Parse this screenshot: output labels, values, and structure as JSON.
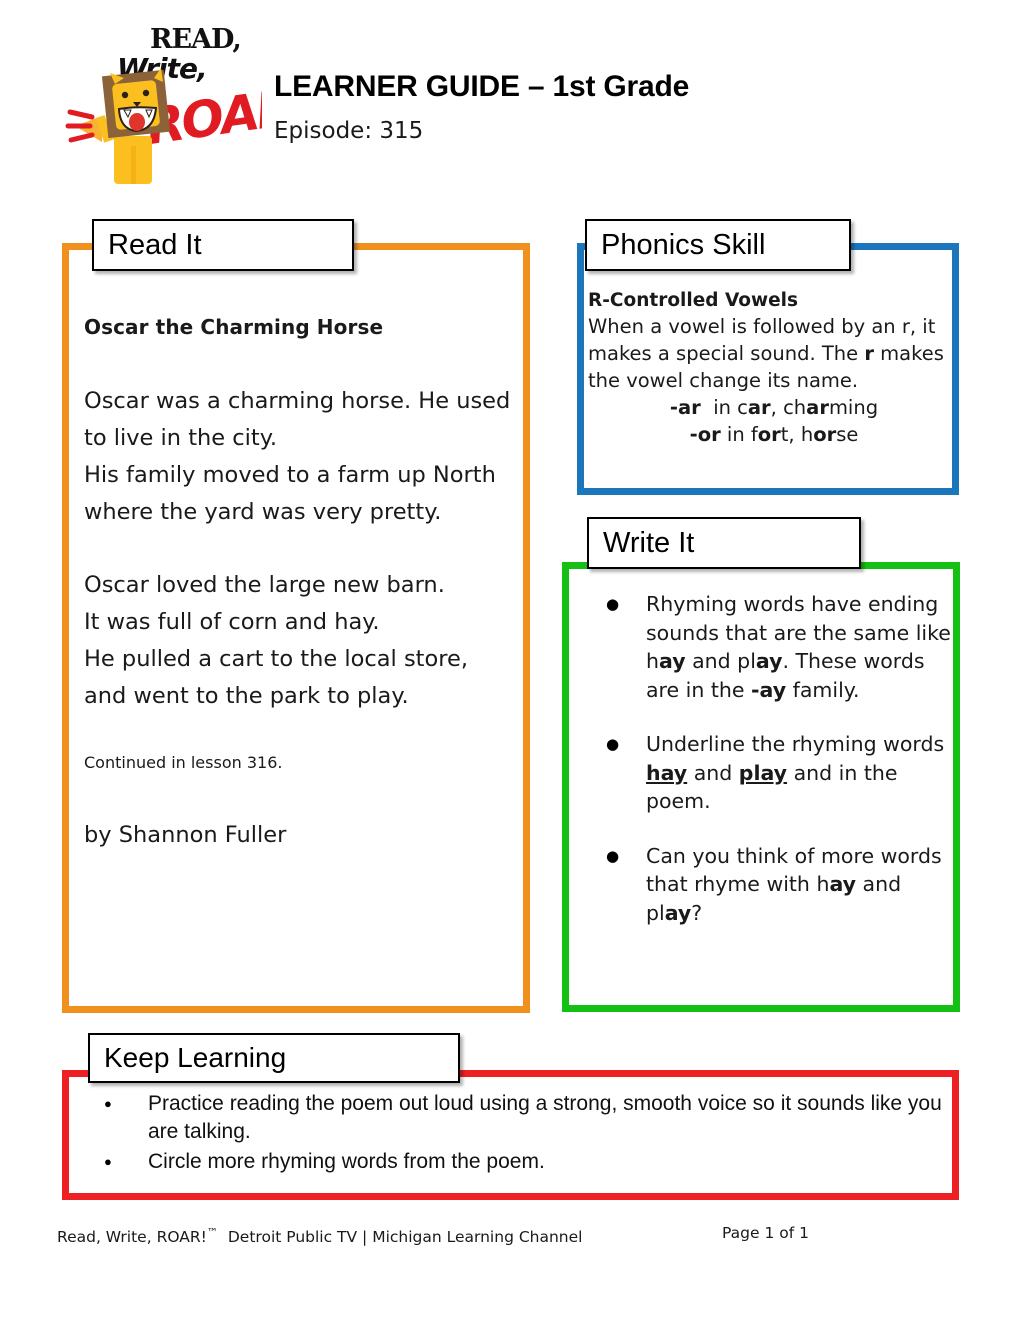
{
  "header": {
    "logo_alt": "Read, Write, ROAR! lion mascot logo",
    "logo_word1": "READ,",
    "logo_word2": "Write,",
    "logo_word3": "ROAR!",
    "title": "LEARNER GUIDE – 1st Grade",
    "episode": "Episode: 315"
  },
  "panels": {
    "read_it": {
      "tab_label": "Read It",
      "border_color": "#F0911E",
      "poem_title": "Oscar the Charming Horse",
      "stanza_1": "Oscar was a charming horse. He used to live in the city.\nHis family moved to a farm up North\nwhere the yard was very pretty.",
      "stanza_1_lines": [
        "Oscar was a charming horse. He used to live in the city.",
        "His family moved to a farm up North",
        "where the yard was very pretty."
      ],
      "stanza_2_lines": [
        "Oscar loved the large new barn.",
        "It was full of corn and hay.",
        "He pulled a cart to the local store,",
        "and went to the park to play."
      ],
      "continued_note": "Continued in lesson 316.",
      "author": "by Shannon Fuller"
    },
    "phonics_skill": {
      "tab_label": "Phonics Skill",
      "border_color": "#1B76BC",
      "heading": "R-Controlled Vowels",
      "body_part_1": "When a vowel is followed by an r, it makes a special sound. The ",
      "body_bold_r": "r",
      "body_part_2": " makes the vowel change its name.",
      "example_ar_prefix": "-ar",
      "example_ar_text": "in c",
      "example_ar_bold1": "ar",
      "example_ar_mid": ", ch",
      "example_ar_bold2": "ar",
      "example_ar_end": "ming",
      "example_or_prefix": "-or",
      "example_or_text": "in f",
      "example_or_bold1": "or",
      "example_or_mid": "t, h",
      "example_or_bold2": "or",
      "example_or_end": "se"
    },
    "write_it": {
      "tab_label": "Write It",
      "border_color": "#13C013",
      "bullets": [
        {
          "segments": [
            {
              "text": "Rhyming words have ending sounds that are the same like h",
              "bold": false,
              "underline": false
            },
            {
              "text": "ay",
              "bold": true,
              "underline": false
            },
            {
              "text": " and pl",
              "bold": false,
              "underline": false
            },
            {
              "text": "ay",
              "bold": true,
              "underline": false
            },
            {
              "text": ". These words are in the ",
              "bold": false,
              "underline": false
            },
            {
              "text": "-ay",
              "bold": true,
              "underline": false
            },
            {
              "text": " family.",
              "bold": false,
              "underline": false
            }
          ]
        },
        {
          "segments": [
            {
              "text": "Underline the rhyming words ",
              "bold": false,
              "underline": false
            },
            {
              "text": "hay",
              "bold": true,
              "underline": true
            },
            {
              "text": " and ",
              "bold": false,
              "underline": false
            },
            {
              "text": "play",
              "bold": true,
              "underline": true
            },
            {
              "text": " and in the poem.",
              "bold": false,
              "underline": false
            }
          ]
        },
        {
          "segments": [
            {
              "text": "Can you think of more words that rhyme with h",
              "bold": false,
              "underline": false
            },
            {
              "text": "ay",
              "bold": true,
              "underline": false
            },
            {
              "text": " and pl",
              "bold": false,
              "underline": false
            },
            {
              "text": "ay",
              "bold": true,
              "underline": false
            },
            {
              "text": "?",
              "bold": false,
              "underline": false
            }
          ]
        }
      ]
    },
    "keep_learning": {
      "tab_label": "Keep Learning",
      "border_color": "#ED2024",
      "bullets": [
        "Practice reading the poem out loud using a strong, smooth voice so it sounds like you are talking.",
        "Circle more rhyming words from the poem."
      ]
    }
  },
  "footer": {
    "brand": "Read, Write, ROAR!",
    "trademark": "™",
    "attribution": "Detroit Public TV | Michigan Learning Channel",
    "page": "Page 1 of 1"
  }
}
